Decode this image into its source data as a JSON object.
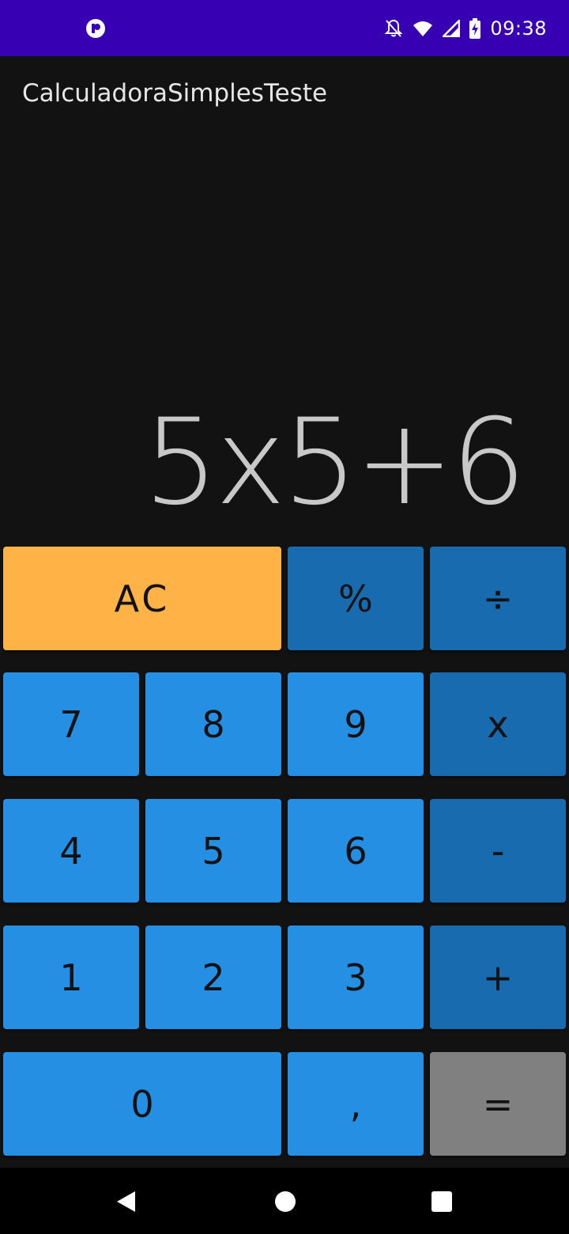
{
  "status_bar": {
    "time": "09:38",
    "icons": [
      "app-notification-icon",
      "bell-off-icon",
      "wifi-icon",
      "signal-icon",
      "battery-charging-icon"
    ]
  },
  "app": {
    "title": "CalculadoraSimplesTeste"
  },
  "display": {
    "expression": "5x5+6"
  },
  "keys": {
    "ac": "AC",
    "percent": "%",
    "divide": "÷",
    "seven": "7",
    "eight": "8",
    "nine": "9",
    "multiply": "x",
    "four": "4",
    "five": "5",
    "six": "6",
    "minus": "-",
    "one": "1",
    "two": "2",
    "three": "3",
    "plus": "+",
    "zero": "0",
    "comma": ",",
    "equals": "="
  },
  "navigation": {
    "buttons": [
      "back-icon",
      "home-icon",
      "recents-icon"
    ]
  },
  "colors": {
    "status_bar": "#3700b3",
    "background": "#121212",
    "number_key": "#258fe3",
    "operator_key": "#186baf",
    "clear_key": "#ffb246",
    "equals_key": "#808080"
  }
}
